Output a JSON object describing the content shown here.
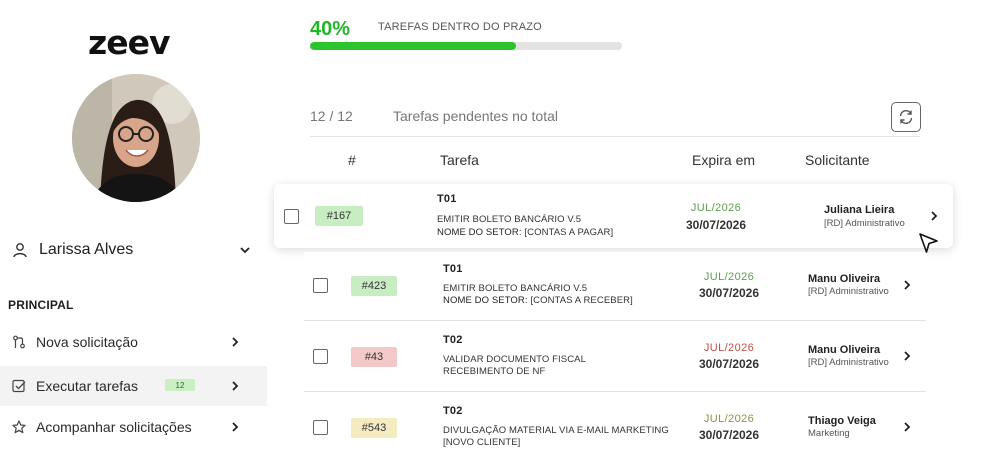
{
  "brand": {
    "logo_text": "zeev"
  },
  "user": {
    "name": "Larissa Alves"
  },
  "sidebar": {
    "section_label": "PRINCIPAL",
    "items": [
      {
        "label": "Nova solicitação",
        "icon": "git-pull-icon"
      },
      {
        "label": "Executar tarefas",
        "icon": "checkbox-icon",
        "badge": "12"
      },
      {
        "label": "Acompanhar solicitações",
        "icon": "star-icon"
      }
    ]
  },
  "progress": {
    "percent_label": "40%",
    "percent": 0.66,
    "label": "TAREFAS DENTRO DO PRAZO"
  },
  "summary": {
    "count": "12 / 12",
    "label": "Tarefas pendentes no total"
  },
  "table": {
    "headers": {
      "num": "#",
      "task": "Tarefa",
      "expires": "Expira em",
      "requester": "Solicitante"
    },
    "rows": [
      {
        "id": "#167",
        "badge_color": "#c9edc3",
        "code": "T01",
        "title": "EMITIR BOLETO BANCÁRIO V.5",
        "sector_label": "NOME DO SETOR:",
        "sector_value": "[CONTAS A PAGAR]",
        "month": "JUL/2026",
        "month_color": "#5aa04c",
        "date": "30/07/2026",
        "requester": "Juliana Lieira",
        "dept": "[RD] Administrativo"
      },
      {
        "id": "#423",
        "badge_color": "#c9edc3",
        "code": "T01",
        "title": "EMITIR BOLETO BANCÁRIO V.5",
        "sector_label": "NOME DO SETOR:",
        "sector_value": "[CONTAS A RECEBER]",
        "month": "JUL/2026",
        "month_color": "#5aa04c",
        "date": "30/07/2026",
        "requester": "Manu Oliveira",
        "dept": "[RD] Administrativo"
      },
      {
        "id": "#43",
        "badge_color": "#f2c8c8",
        "code": "T02",
        "title": "VALIDAR DOCUMENTO FISCAL",
        "sector_label": "",
        "sector_value": "RECEBIMENTO DE NF",
        "month": "JUL/2026",
        "month_color": "#c0504a",
        "date": "30/07/2026",
        "requester": "Manu Oliveira",
        "dept": "[RD] Administrativo"
      },
      {
        "id": "#543",
        "badge_color": "#f4ecc0",
        "code": "T02",
        "title": "DIVULGAÇÃO MATERIAL VIA E-MAIL MARKETING",
        "sector_label": "",
        "sector_value": "[NOVO CLIENTE]",
        "month": "JUL/2026",
        "month_color": "#9a8a45",
        "date": "30/07/2026",
        "requester": "Thiago Veiga",
        "dept": "Marketing"
      }
    ]
  }
}
